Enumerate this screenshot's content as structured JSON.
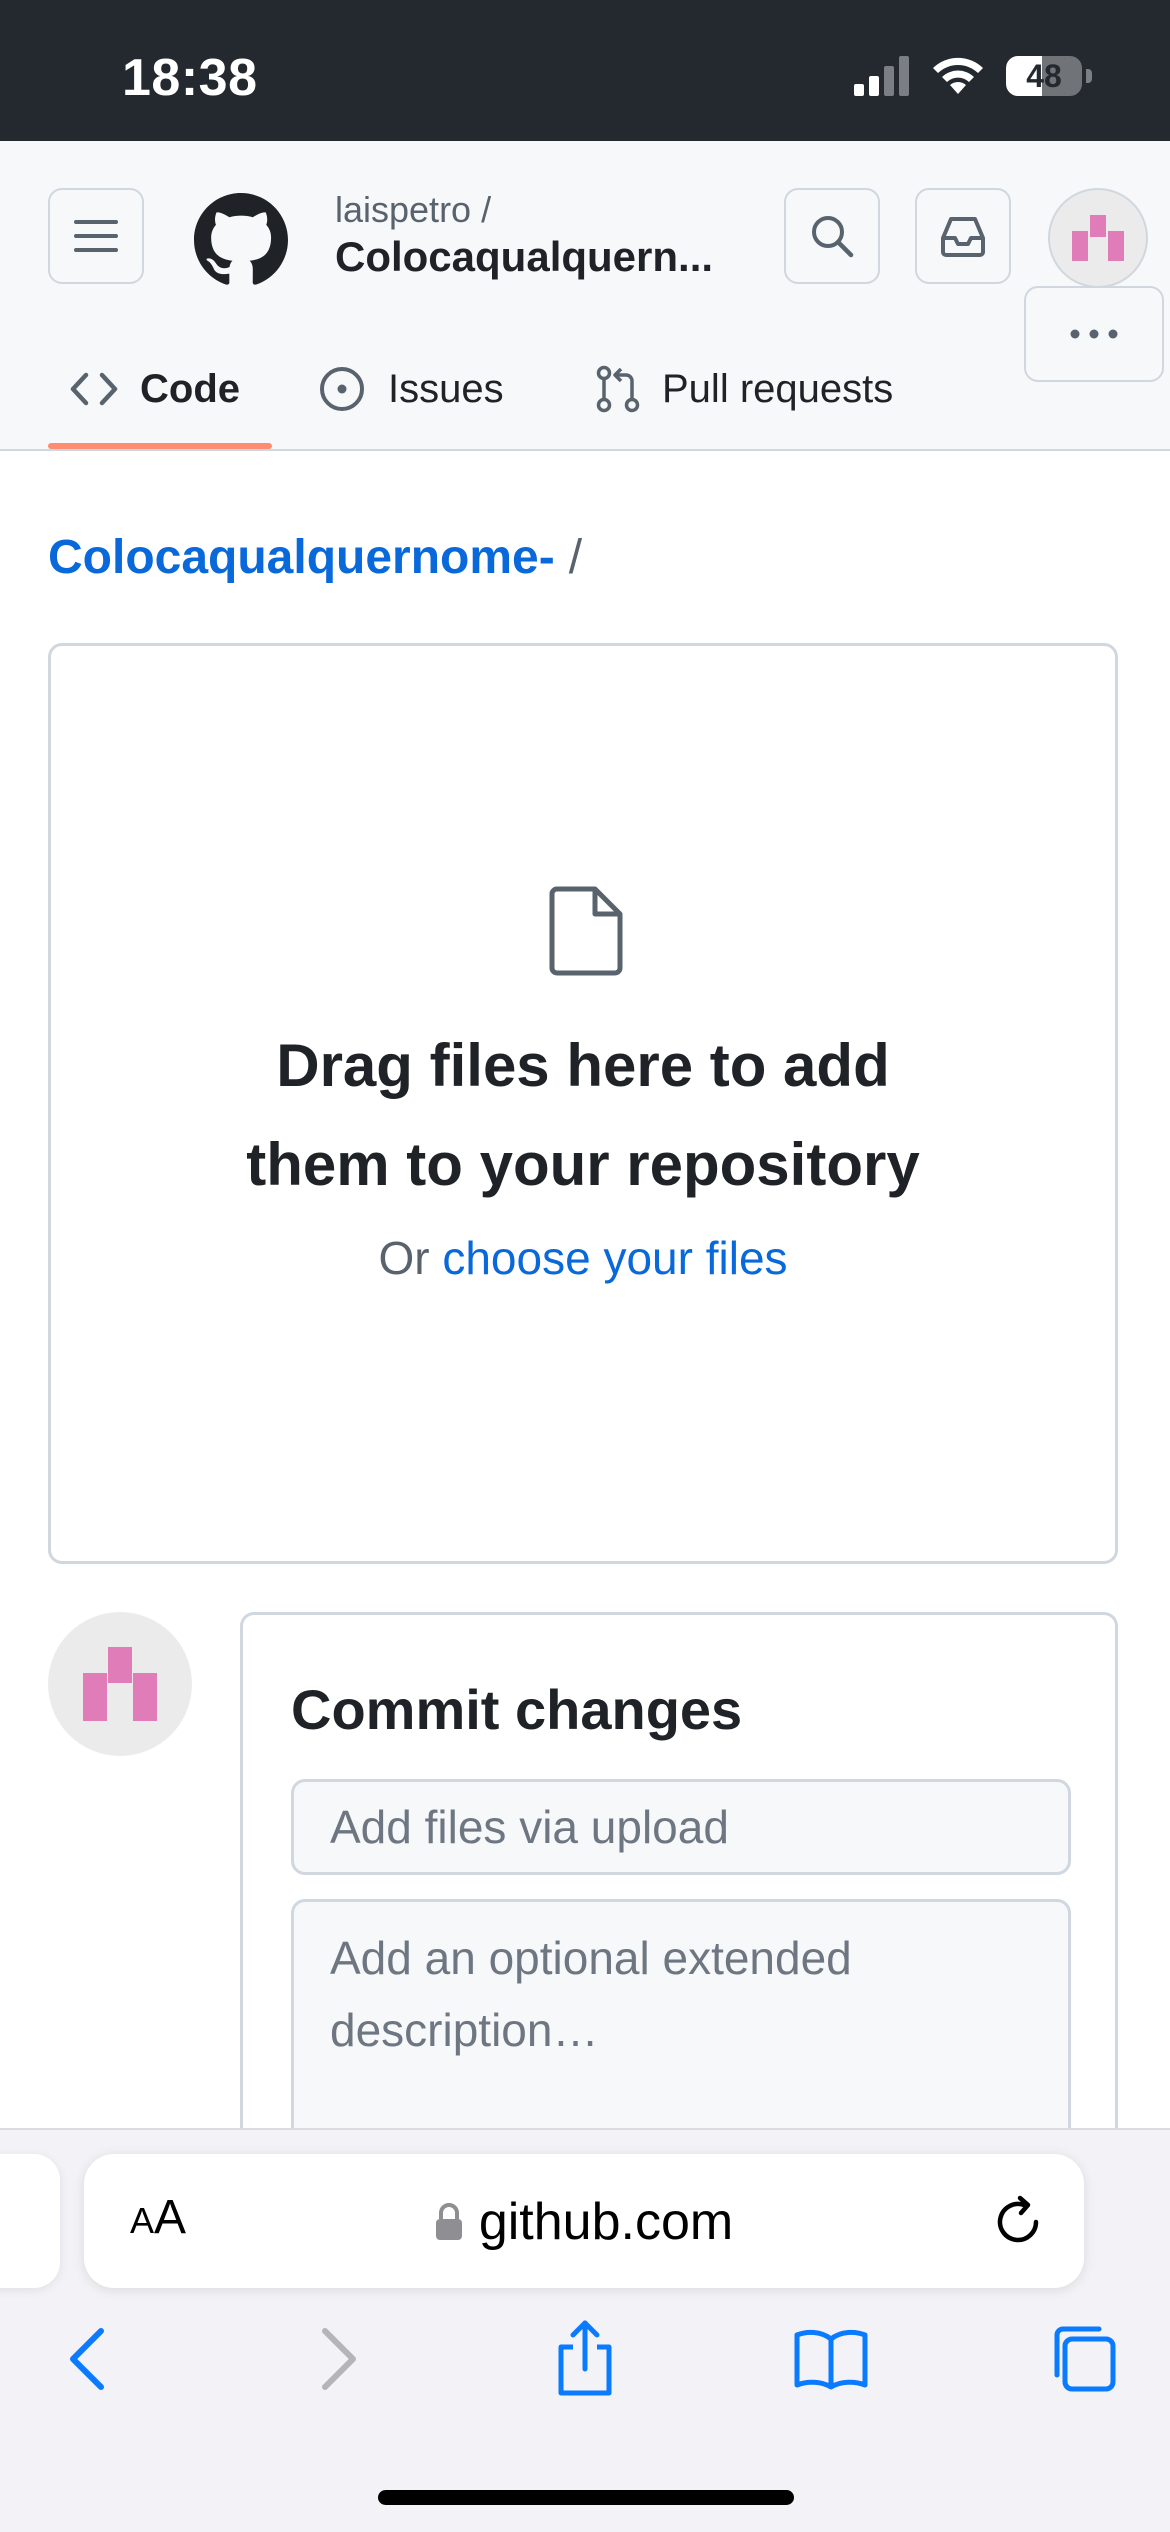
{
  "status_bar": {
    "time": "18:38",
    "battery_level": 48,
    "battery_text": "48",
    "icons": [
      "cellular-signal-icon",
      "wifi-icon",
      "battery-icon"
    ]
  },
  "header": {
    "repo_owner": "laispetro /",
    "repo_name": "Colocaqualquern...",
    "icons": [
      "menu-icon",
      "github-logo",
      "search-icon",
      "inbox-icon",
      "avatar"
    ]
  },
  "tabs": [
    {
      "label": "Code",
      "icon": "code-icon",
      "selected": true
    },
    {
      "label": "Issues",
      "icon": "issue-opened-icon",
      "selected": false
    },
    {
      "label": "Pull requests",
      "icon": "git-pull-request-icon",
      "selected": false
    }
  ],
  "breadcrumb": {
    "repo_link": "Colocaqualquernome-",
    "separator": "/"
  },
  "dropzone": {
    "title": "Drag files here to add them to your repository",
    "or_text": "Or ",
    "choose_link": "choose your files"
  },
  "commit": {
    "title": "Commit changes",
    "summary_placeholder": "Add files via upload",
    "description_placeholder": "Add an optional extended description…"
  },
  "safari": {
    "aa_label_small": "A",
    "aa_label_large": "A",
    "url": "github.com",
    "toolbar_icons": [
      "back-icon",
      "forward-icon",
      "share-icon",
      "bookmarks-icon",
      "tabs-icon"
    ]
  },
  "colors": {
    "status_bar_bg": "#24292f",
    "link_blue": "#0969da",
    "tab_underline": "#fd8c73",
    "avatar_pink": "#e07cb8",
    "safari_blue": "#0a7aff"
  }
}
